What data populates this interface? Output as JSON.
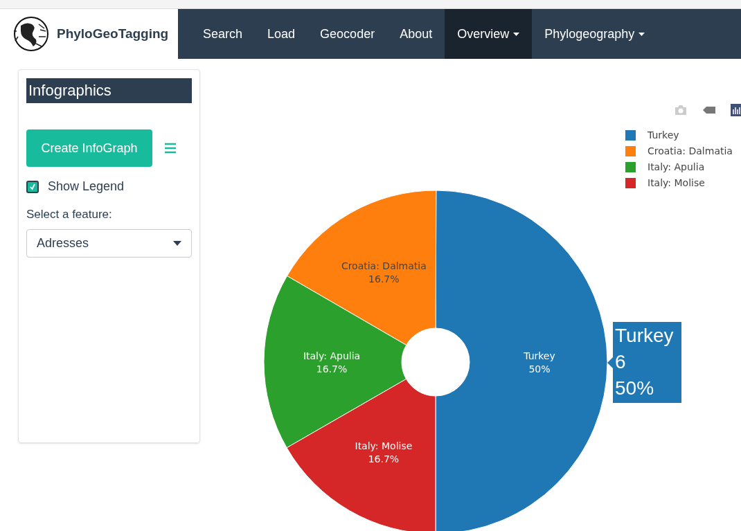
{
  "navbar": {
    "brand": "PhyloGeoTagging",
    "items": [
      {
        "label": "Search",
        "selected": false,
        "dropdown": false
      },
      {
        "label": "Load",
        "selected": false,
        "dropdown": false
      },
      {
        "label": "Geocoder",
        "selected": false,
        "dropdown": false
      },
      {
        "label": "About",
        "selected": false,
        "dropdown": false
      },
      {
        "label": "Overview",
        "selected": true,
        "dropdown": true
      },
      {
        "label": "Phylogeography",
        "selected": false,
        "dropdown": true
      }
    ]
  },
  "sidebar": {
    "title": "Infographics",
    "create_button": "Create InfoGraph",
    "show_legend": {
      "label": "Show Legend",
      "checked": true
    },
    "feature_label": "Select a feature:",
    "feature_select": {
      "value": "Adresses"
    }
  },
  "chart": {
    "chart_data": {
      "type": "donut",
      "categories": [
        "Turkey",
        "Croatia: Dalmatia",
        "Italy: Apulia",
        "Italy: Molise"
      ],
      "values": [
        50,
        16.7,
        16.7,
        16.7
      ],
      "value_labels": [
        "50%",
        "16.7%",
        "16.7%",
        "16.7%"
      ],
      "colors": [
        "#1f77b4",
        "#ff7f0e",
        "#2ca02c",
        "#d62728"
      ]
    },
    "hover": {
      "label": "Turkey",
      "value": "6",
      "percent": "50%"
    }
  }
}
